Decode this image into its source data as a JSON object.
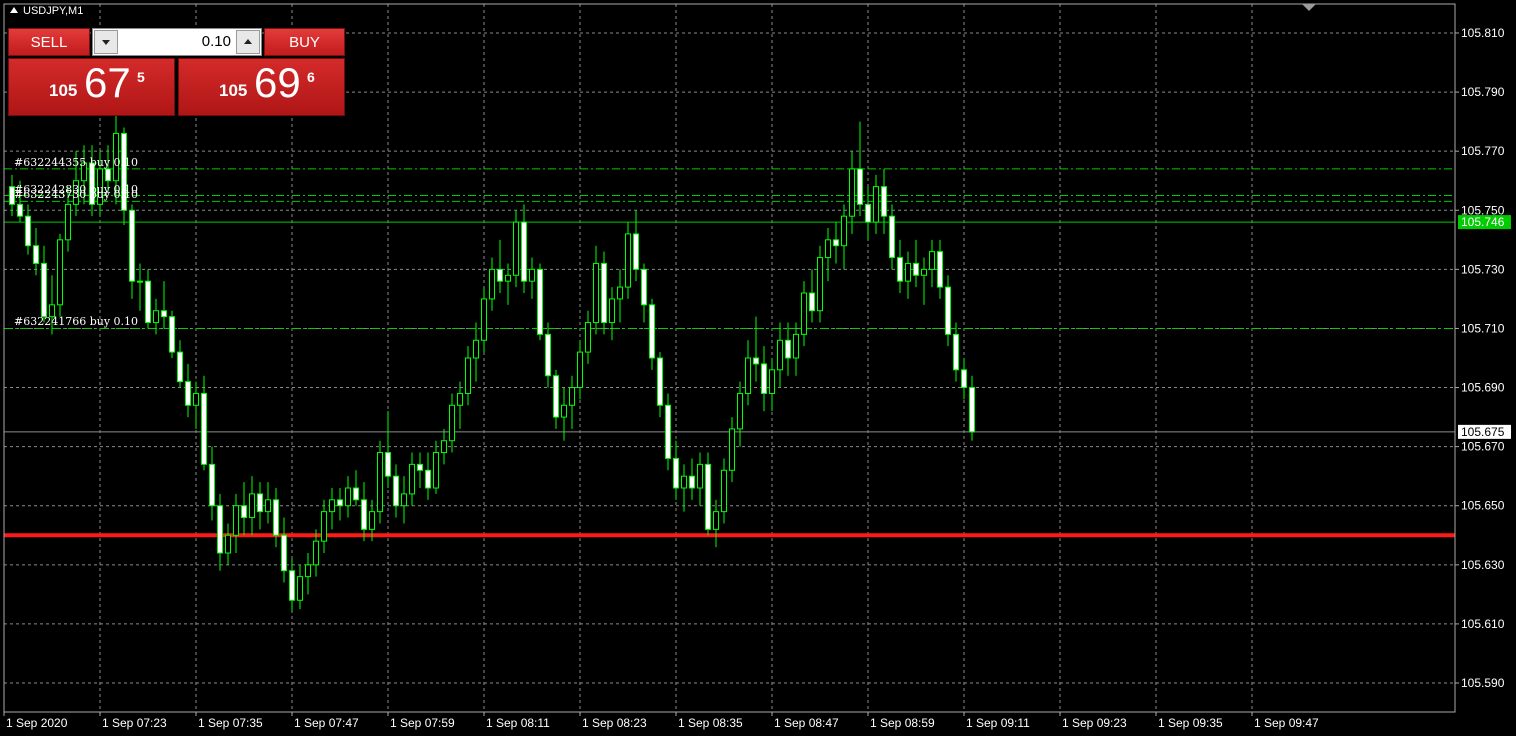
{
  "window": {
    "symbol_title": "USDJPY,M1"
  },
  "trade_panel": {
    "sell_label": "SELL",
    "buy_label": "BUY",
    "lot": "0.10",
    "bid": {
      "small": "105",
      "big": "67",
      "sup": "5"
    },
    "ask": {
      "small": "105",
      "big": "69",
      "sup": "6"
    }
  },
  "orders": [
    {
      "label": "#632244355 buy 0.10",
      "price": 105.764
    },
    {
      "label": "#632242830 buy 0.10",
      "price": 105.755
    },
    {
      "label": "#632243730 buy 0.10",
      "price": 105.753
    },
    {
      "label": "#632241766 buy 0.10",
      "price": 105.71
    }
  ],
  "colors": {
    "background": "#000000",
    "grid": "#8a8a8a",
    "candle": "#00ff00",
    "candle_body": "#ffffff",
    "level_line": "#ff1a1a",
    "ask_line": "#00cc00",
    "bid_line": "#8c8c8c"
  },
  "chart_data": {
    "type": "candlestick",
    "symbol": "USDJPY",
    "timeframe": "M1",
    "ylim": [
      105.58,
      105.82
    ],
    "y_ticks": [
      "105.810",
      "105.790",
      "105.770",
      "105.750",
      "105.730",
      "105.710",
      "105.690",
      "105.670",
      "105.650",
      "105.630",
      "105.610",
      "105.590"
    ],
    "x_ticks": [
      "1 Sep 2020",
      "1 Sep 07:23",
      "1 Sep 07:35",
      "1 Sep 07:47",
      "1 Sep 07:59",
      "1 Sep 08:11",
      "1 Sep 08:23",
      "1 Sep 08:35",
      "1 Sep 08:47",
      "1 Sep 08:59",
      "1 Sep 09:11",
      "1 Sep 09:23",
      "1 Sep 09:35",
      "1 Sep 09:47"
    ],
    "current_ask": "105.746",
    "current_bid": "105.675",
    "horizontal_level": 105.64,
    "ohlc": [
      [
        105.758,
        105.762,
        105.748,
        105.752
      ],
      [
        105.752,
        105.76,
        105.746,
        105.748
      ],
      [
        105.748,
        105.752,
        105.735,
        105.738
      ],
      [
        105.738,
        105.744,
        105.728,
        105.732
      ],
      [
        105.732,
        105.738,
        105.712,
        105.714
      ],
      [
        105.714,
        105.728,
        105.708,
        105.718
      ],
      [
        105.718,
        105.742,
        105.714,
        105.74
      ],
      [
        105.74,
        105.758,
        105.736,
        105.752
      ],
      [
        105.752,
        105.77,
        105.748,
        105.76
      ],
      [
        105.76,
        105.772,
        105.752,
        105.766
      ],
      [
        105.766,
        105.772,
        105.748,
        105.752
      ],
      [
        105.752,
        105.77,
        105.748,
        105.764
      ],
      [
        105.764,
        105.772,
        105.756,
        105.76
      ],
      [
        105.76,
        105.782,
        105.752,
        105.776
      ],
      [
        105.776,
        105.778,
        105.745,
        105.75
      ],
      [
        105.75,
        105.752,
        105.72,
        105.726
      ],
      [
        105.726,
        105.732,
        105.716,
        105.726
      ],
      [
        105.726,
        105.73,
        105.71,
        105.712
      ],
      [
        105.712,
        105.72,
        105.708,
        105.716
      ],
      [
        105.716,
        105.726,
        105.71,
        105.714
      ],
      [
        105.714,
        105.716,
        105.7,
        105.702
      ],
      [
        105.702,
        105.706,
        105.69,
        105.692
      ],
      [
        105.692,
        105.698,
        105.68,
        105.684
      ],
      [
        105.684,
        105.692,
        105.676,
        105.688
      ],
      [
        105.688,
        105.694,
        105.662,
        105.664
      ],
      [
        105.664,
        105.67,
        105.645,
        105.65
      ],
      [
        105.65,
        105.654,
        105.628,
        105.634
      ],
      [
        105.634,
        105.644,
        105.63,
        105.64
      ],
      [
        105.64,
        105.654,
        105.634,
        105.65
      ],
      [
        105.65,
        105.658,
        105.64,
        105.646
      ],
      [
        105.646,
        105.66,
        105.64,
        105.654
      ],
      [
        105.654,
        105.658,
        105.642,
        105.648
      ],
      [
        105.648,
        105.658,
        105.644,
        105.652
      ],
      [
        105.652,
        105.656,
        105.636,
        105.64
      ],
      [
        105.64,
        105.646,
        105.624,
        105.628
      ],
      [
        105.628,
        105.632,
        105.614,
        105.618
      ],
      [
        105.618,
        105.63,
        105.615,
        105.626
      ],
      [
        105.626,
        105.634,
        105.62,
        105.63
      ],
      [
        105.63,
        105.642,
        105.626,
        105.638
      ],
      [
        105.638,
        105.652,
        105.634,
        105.648
      ],
      [
        105.648,
        105.656,
        105.642,
        105.652
      ],
      [
        105.652,
        105.656,
        105.645,
        105.65
      ],
      [
        105.65,
        105.66,
        105.646,
        105.656
      ],
      [
        105.656,
        105.662,
        105.65,
        105.652
      ],
      [
        105.652,
        105.658,
        105.638,
        105.642
      ],
      [
        105.642,
        105.652,
        105.638,
        105.648
      ],
      [
        105.648,
        105.672,
        105.644,
        105.668
      ],
      [
        105.668,
        105.682,
        105.656,
        105.66
      ],
      [
        105.66,
        105.664,
        105.646,
        105.65
      ],
      [
        105.65,
        105.66,
        105.644,
        105.654
      ],
      [
        105.654,
        105.668,
        105.65,
        105.664
      ],
      [
        105.664,
        105.668,
        105.656,
        105.662
      ],
      [
        105.662,
        105.668,
        105.652,
        105.656
      ],
      [
        105.656,
        105.672,
        105.654,
        105.668
      ],
      [
        105.668,
        105.676,
        105.664,
        105.672
      ],
      [
        105.672,
        105.688,
        105.668,
        105.684
      ],
      [
        105.684,
        105.692,
        105.676,
        105.688
      ],
      [
        105.688,
        105.704,
        105.684,
        105.7
      ],
      [
        105.7,
        105.712,
        105.692,
        105.706
      ],
      [
        105.706,
        105.724,
        105.702,
        105.72
      ],
      [
        105.72,
        105.734,
        105.716,
        105.73
      ],
      [
        105.73,
        105.74,
        105.722,
        105.726
      ],
      [
        105.726,
        105.732,
        105.718,
        105.728
      ],
      [
        105.728,
        105.75,
        105.724,
        105.746
      ],
      [
        105.746,
        105.752,
        105.722,
        105.726
      ],
      [
        105.726,
        105.734,
        105.72,
        105.73
      ],
      [
        105.73,
        105.732,
        105.706,
        105.708
      ],
      [
        105.708,
        105.712,
        105.69,
        105.694
      ],
      [
        105.694,
        105.696,
        105.676,
        105.68
      ],
      [
        105.68,
        105.69,
        105.672,
        105.684
      ],
      [
        105.684,
        105.694,
        105.676,
        105.69
      ],
      [
        105.69,
        105.706,
        105.686,
        105.702
      ],
      [
        105.702,
        105.716,
        105.698,
        105.712
      ],
      [
        105.712,
        105.738,
        105.708,
        105.732
      ],
      [
        105.732,
        105.736,
        105.708,
        105.712
      ],
      [
        105.712,
        105.724,
        105.706,
        105.72
      ],
      [
        105.72,
        105.73,
        105.712,
        105.724
      ],
      [
        105.724,
        105.746,
        105.72,
        105.742
      ],
      [
        105.742,
        105.75,
        105.726,
        105.73
      ],
      [
        105.73,
        105.732,
        105.712,
        105.718
      ],
      [
        105.718,
        105.72,
        105.696,
        105.7
      ],
      [
        105.7,
        105.702,
        105.68,
        105.684
      ],
      [
        105.684,
        105.688,
        105.662,
        105.666
      ],
      [
        105.666,
        105.672,
        105.652,
        105.656
      ],
      [
        105.656,
        105.664,
        105.648,
        105.66
      ],
      [
        105.66,
        105.666,
        105.652,
        105.656
      ],
      [
        105.656,
        105.668,
        105.65,
        105.664
      ],
      [
        105.664,
        105.668,
        105.64,
        105.642
      ],
      [
        105.642,
        105.652,
        105.636,
        105.648
      ],
      [
        105.648,
        105.666,
        105.644,
        105.662
      ],
      [
        105.662,
        105.68,
        105.658,
        105.676
      ],
      [
        105.676,
        105.692,
        105.67,
        105.688
      ],
      [
        105.688,
        105.706,
        105.684,
        105.7
      ],
      [
        105.7,
        105.714,
        105.692,
        105.698
      ],
      [
        105.698,
        105.704,
        105.682,
        105.688
      ],
      [
        105.688,
        105.7,
        105.682,
        105.696
      ],
      [
        105.696,
        105.712,
        105.69,
        105.706
      ],
      [
        105.706,
        105.712,
        105.694,
        105.7
      ],
      [
        105.7,
        105.712,
        105.694,
        105.708
      ],
      [
        105.708,
        105.726,
        105.704,
        105.722
      ],
      [
        105.722,
        105.73,
        105.712,
        105.716
      ],
      [
        105.716,
        105.738,
        105.712,
        105.734
      ],
      [
        105.734,
        105.744,
        105.726,
        105.74
      ],
      [
        105.74,
        105.746,
        105.732,
        105.738
      ],
      [
        105.738,
        105.752,
        105.73,
        105.748
      ],
      [
        105.748,
        105.77,
        105.742,
        105.764
      ],
      [
        105.764,
        105.78,
        105.748,
        105.752
      ],
      [
        105.752,
        105.758,
        105.74,
        105.746
      ],
      [
        105.746,
        105.762,
        105.742,
        105.758
      ],
      [
        105.758,
        105.764,
        105.742,
        105.748
      ],
      [
        105.748,
        105.752,
        105.73,
        105.734
      ],
      [
        105.734,
        105.74,
        105.722,
        105.726
      ],
      [
        105.726,
        105.736,
        105.72,
        105.732
      ],
      [
        105.732,
        105.74,
        105.724,
        105.728
      ],
      [
        105.728,
        105.734,
        105.718,
        105.73
      ],
      [
        105.73,
        105.74,
        105.724,
        105.736
      ],
      [
        105.736,
        105.74,
        105.72,
        105.724
      ],
      [
        105.724,
        105.728,
        105.704,
        105.708
      ],
      [
        105.708,
        105.712,
        105.692,
        105.696
      ],
      [
        105.696,
        105.7,
        105.686,
        105.69
      ],
      [
        105.69,
        105.694,
        105.672,
        105.675
      ]
    ]
  }
}
